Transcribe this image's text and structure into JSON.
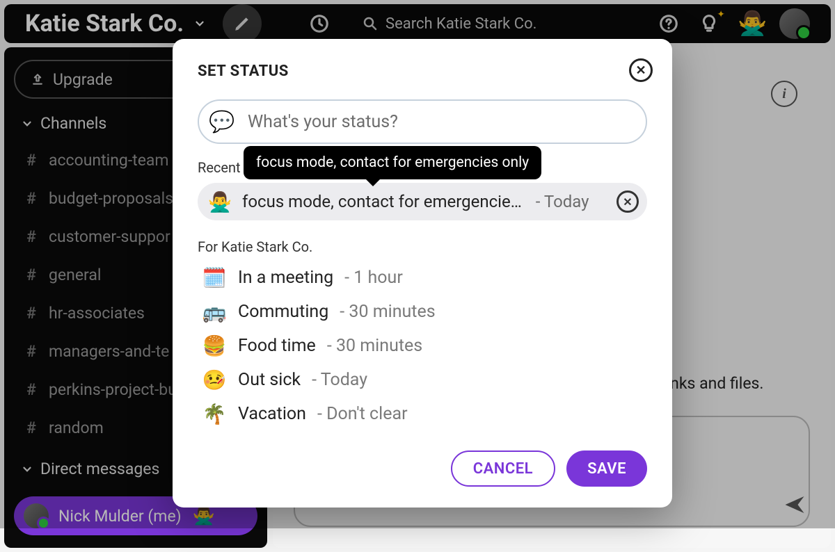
{
  "workspace": {
    "name": "Katie Stark Co."
  },
  "topbar": {
    "search_placeholder": "Search Katie Stark Co."
  },
  "sidebar": {
    "upgrade_label": "Upgrade",
    "channels_header": "Channels",
    "channels": [
      "accounting-team",
      "budget-proposals",
      "customer-suppor",
      "general",
      "hr-associates",
      "managers-and-te",
      "perkins-project-bu",
      "random"
    ],
    "dm_header": "Direct messages",
    "dm_self": "Nick Mulder (me)",
    "dm_self_status_emoji": "🙅‍♂️"
  },
  "main": {
    "hint_tail": "links and files."
  },
  "modal": {
    "title": "SET STATUS",
    "input_placeholder": "What's your status?",
    "input_emoji": "💬",
    "recent_label": "Recent",
    "recent": {
      "emoji": "🙅‍♂️",
      "text_truncated": "focus mode, contact for emergencie…",
      "text_full": "focus mode, contact for emergencies only",
      "duration": "Today"
    },
    "presets_label": "For Katie Stark Co.",
    "presets": [
      {
        "emoji": "🗓️",
        "label": "In a meeting",
        "duration": "1 hour"
      },
      {
        "emoji": "🚌",
        "label": "Commuting",
        "duration": "30 minutes"
      },
      {
        "emoji": "🍔",
        "label": "Food time",
        "duration": "30 minutes"
      },
      {
        "emoji": "🤒",
        "label": "Out sick",
        "duration": "Today"
      },
      {
        "emoji": "🌴",
        "label": "Vacation",
        "duration": "Don't clear"
      }
    ],
    "cancel_label": "CANCEL",
    "save_label": "SAVE"
  },
  "colors": {
    "accent": "#7a36d9"
  }
}
